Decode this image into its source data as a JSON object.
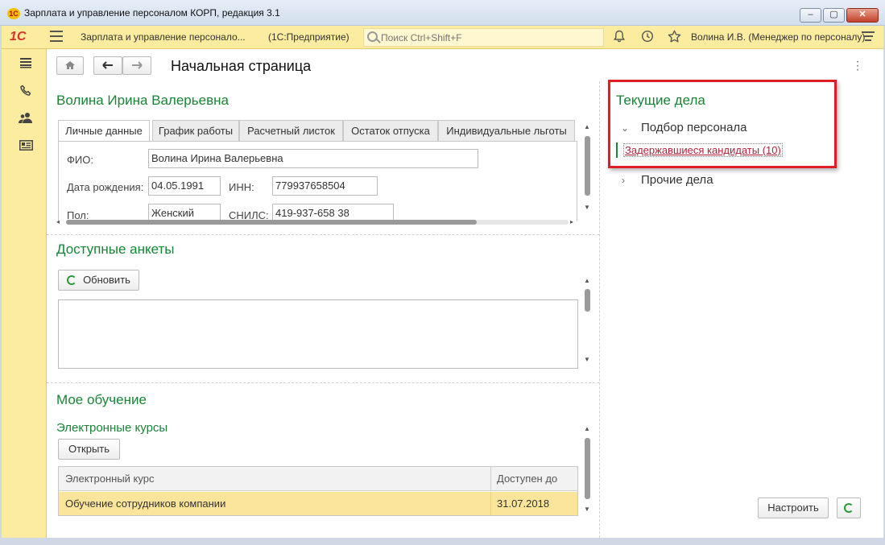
{
  "window": {
    "title": "Зарплата и управление персоналом КОРП, редакция 3.1",
    "controls": [
      "–",
      "▢",
      "✕"
    ]
  },
  "appbar": {
    "logo": "1С",
    "app_name": "Зарплата и управление персонало...",
    "platform": "(1С:Предприятие)",
    "search_placeholder": "Поиск Ctrl+Shift+F",
    "user": "Волина И.В. (Менеджер по персоналу)",
    "icons": [
      "bell-icon",
      "history-icon",
      "star-icon",
      "menu-icon"
    ]
  },
  "sidebar": {
    "items": [
      "menu-icon",
      "phone-icon",
      "users-icon",
      "id-card-icon"
    ]
  },
  "nav": {
    "home": "⌂",
    "back": "🡐",
    "forward": "🡒",
    "page_title": "Начальная страница",
    "more": "⋮"
  },
  "employee": {
    "name": "Волина Ирина Валерьевна",
    "tabs": [
      "Личные данные",
      "График работы",
      "Расчетный листок",
      "Остаток отпуска",
      "Индивидуальные льготы"
    ],
    "fields": {
      "fio_label": "ФИО:",
      "fio_value": "Волина Ирина Валерьевна",
      "birth_label": "Дата рождения:",
      "birth_value": "04.05.1991",
      "inn_label": "ИНН:",
      "inn_value": "779937658504",
      "gender_label": "Пол:",
      "gender_value": "Женский",
      "snils_label": "СНИЛС:",
      "snils_value": "419-937-658 38"
    }
  },
  "questionnaires": {
    "title": "Доступные анкеты",
    "refresh_label": "Обновить"
  },
  "training": {
    "title": "Мое обучение",
    "subtitle": "Электронные курсы",
    "open_label": "Открыть",
    "columns": [
      "Электронный курс",
      "Доступен до"
    ],
    "rows": [
      {
        "course": "Обучение сотрудников компании",
        "until": "31.07.2018"
      }
    ]
  },
  "tasks": {
    "title": "Текущие дела",
    "group1": "Подбор персонала",
    "group1_item": "Задержавшиеся кандидаты (10)",
    "group2": "Прочие дела",
    "configure_label": "Настроить"
  },
  "colors": {
    "accent_green": "#188436",
    "appbar_yellow": "#fbeca0",
    "selected_row": "#fbe59a",
    "highlight_red": "#e01d24",
    "link_red": "#b0233a"
  }
}
